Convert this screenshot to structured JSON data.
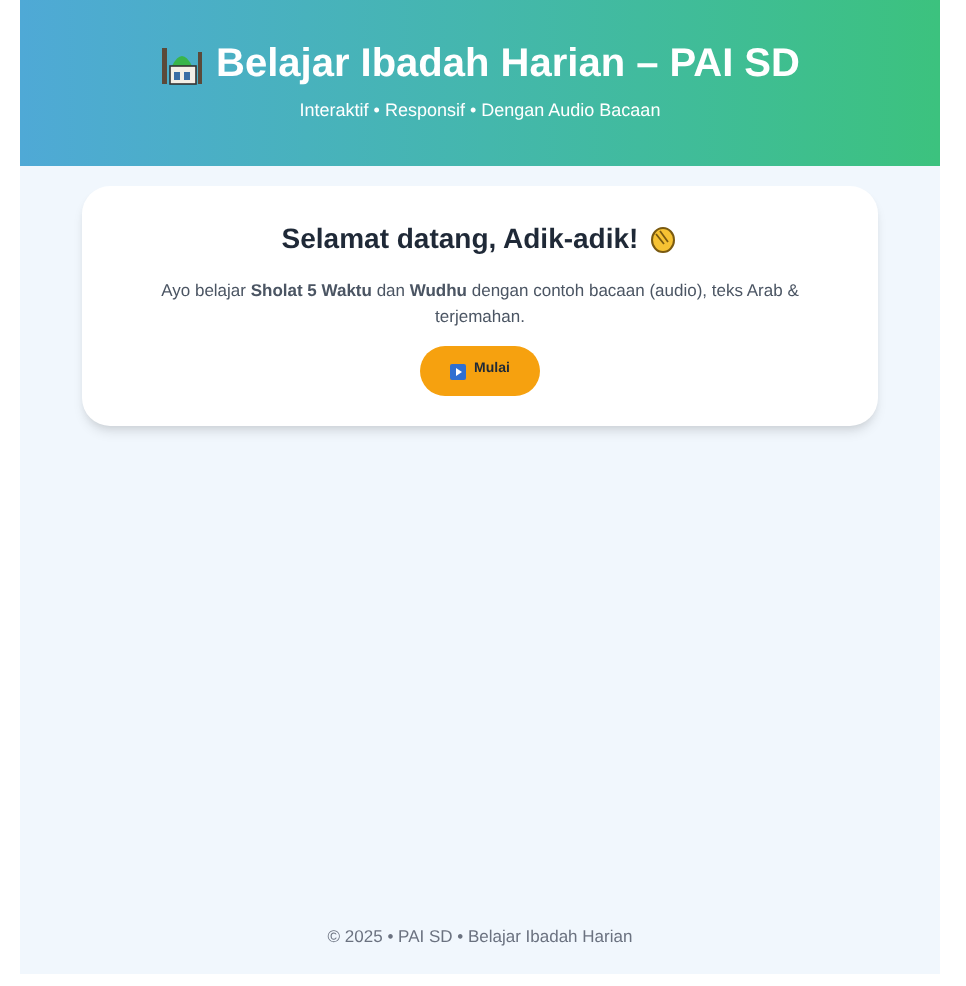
{
  "header": {
    "title": "Belajar Ibadah Harian – PAI SD",
    "subtitle": "Interaktif • Responsif • Dengan Audio Bacaan"
  },
  "welcome": {
    "heading": "Selamat datang, Adik-adik!",
    "text": "Ayo belajar **Sholat 5 Waktu** dan **Wudhu** dengan contoh bacaan (audio), teks Arab & terjemahan.",
    "button": "Mulai"
  },
  "footer": "© 2025 • PAI SD • Belajar Ibadah Harian"
}
